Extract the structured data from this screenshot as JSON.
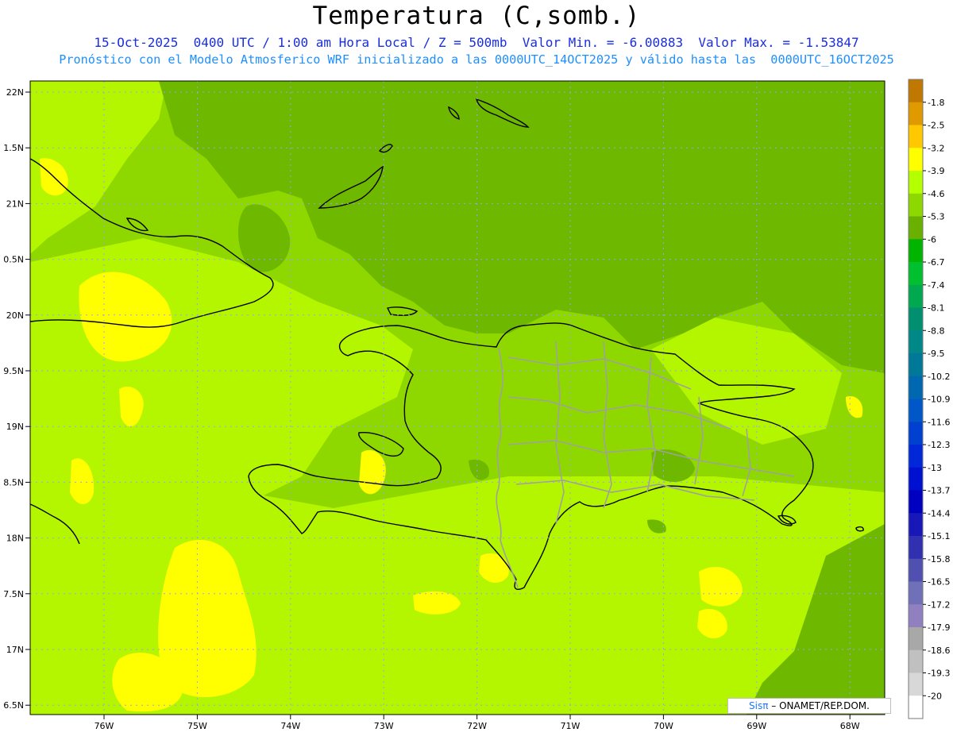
{
  "header": {
    "title": "Temperatura (C,somb.)",
    "line1": "15-Oct-2025  0400 UTC / 1:00 am Hora Local / Z = 500mb  Valor Min. = -6.00883  Valor Max. = -1.53847",
    "line2": "Pronóstico con el Modelo Atmosferico WRF inicializado a las 0000UTC_14OCT2025 y válido hasta las  0000UTC_16OCT2025"
  },
  "axes": {
    "lat_labels": [
      "22N",
      "1.5N",
      "21N",
      "0.5N",
      "20N",
      "9.5N",
      "19N",
      "8.5N",
      "18N",
      "7.5N",
      "17N",
      "6.5N"
    ],
    "lon_labels": [
      "76W",
      "75W",
      "74W",
      "73W",
      "72W",
      "71W",
      "70W",
      "69W",
      "68W"
    ]
  },
  "colorbar": {
    "labels": [
      "-1.8",
      "-2.5",
      "-3.2",
      "-3.9",
      "-4.6",
      "-5.3",
      "-6",
      "-6.7",
      "-7.4",
      "-8.1",
      "-8.8",
      "-9.5",
      "-10.2",
      "-10.9",
      "-11.6",
      "-12.3",
      "-13",
      "-13.7",
      "-14.4",
      "-15.1",
      "-15.8",
      "-16.5",
      "-17.2",
      "-17.9",
      "-18.6",
      "-19.3",
      "-20"
    ],
    "colors": [
      "#c07800",
      "#e09a00",
      "#ffc800",
      "#ffff00",
      "#b4ff00",
      "#8cd800",
      "#6ab000",
      "#00b400",
      "#00c030",
      "#00a850",
      "#009070",
      "#008888",
      "#007898",
      "#0068b0",
      "#0058c8",
      "#0040d0",
      "#0028d8",
      "#0010d0",
      "#0000c0",
      "#1818b8",
      "#3030b0",
      "#5050b0",
      "#7070b8",
      "#9080c0",
      "#a8a8a8",
      "#c0c0c0",
      "#d8d8d8",
      "#ffffff"
    ]
  },
  "map_colors": {
    "background": "#8ed800",
    "light": "#b4f500",
    "yellow": "#ffff00",
    "dark": "#6eb800"
  },
  "credit": {
    "brand": "Sisπ",
    "text": " – ONAMET/REP.DOM."
  }
}
